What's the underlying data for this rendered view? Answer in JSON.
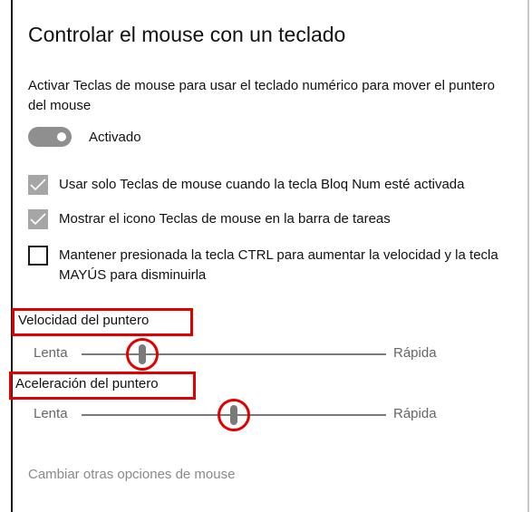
{
  "page": {
    "title": "Controlar el mouse con un teclado",
    "description": "Activar Teclas de mouse para usar el teclado numérico para mover el puntero del mouse"
  },
  "toggle": {
    "label": "Activado",
    "state": "on"
  },
  "checkboxes": [
    {
      "label": "Usar solo Teclas de mouse cuando la tecla Bloq Num esté activada",
      "checked": true
    },
    {
      "label": "Mostrar el icono Teclas de mouse en la barra de tareas",
      "checked": true
    },
    {
      "label": "Mantener presionada la tecla CTRL para aumentar la velocidad y la tecla MAYÚS para disminuirla",
      "checked": false
    }
  ],
  "sliders": {
    "speed": {
      "label": "Velocidad del puntero",
      "min_label": "Lenta",
      "max_label": "Rápida",
      "value_fraction": 0.2
    },
    "acceleration": {
      "label": "Aceleración del puntero",
      "min_label": "Lenta",
      "max_label": "Rápida",
      "value_fraction": 0.5
    }
  },
  "link": {
    "label": "Cambiar otras opciones de mouse"
  },
  "colors": {
    "highlight": "#e00000",
    "toggle": "#8f8f8f",
    "checked_box": "#a6a6a6",
    "muted_text": "#8a8a8a"
  }
}
